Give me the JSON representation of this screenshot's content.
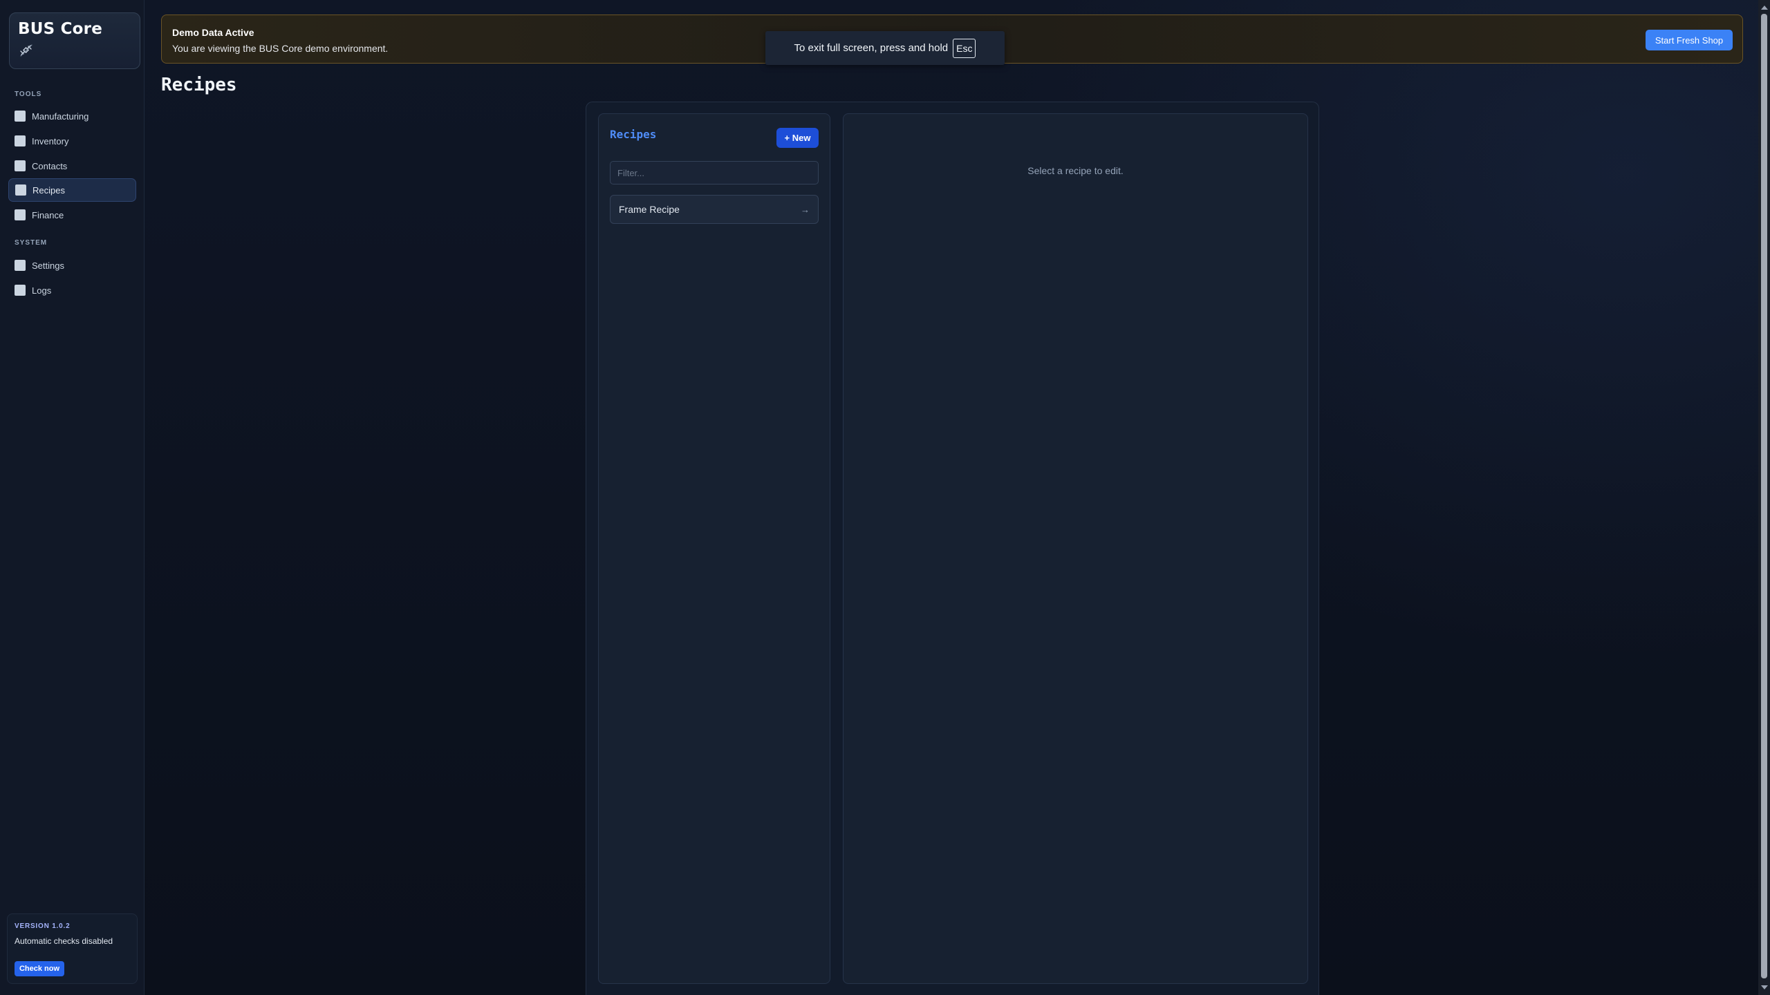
{
  "brand": {
    "title": "BUS Core",
    "icon": "satellite-icon"
  },
  "sidebar": {
    "sections": [
      {
        "label": "TOOLS",
        "items": [
          {
            "label": "Manufacturing",
            "active": false
          },
          {
            "label": "Inventory",
            "active": false
          },
          {
            "label": "Contacts",
            "active": false
          },
          {
            "label": "Recipes",
            "active": true
          },
          {
            "label": "Finance",
            "active": false
          }
        ]
      },
      {
        "label": "SYSTEM",
        "items": [
          {
            "label": "Settings",
            "active": false
          },
          {
            "label": "Logs",
            "active": false
          }
        ]
      }
    ],
    "version": {
      "label": "VERSION 1.0.2",
      "status": "Automatic checks disabled",
      "check_button": "Check now"
    }
  },
  "banner": {
    "title": "Demo Data Active",
    "text": "You are viewing the BUS Core demo environment.",
    "button": "Start Fresh Shop"
  },
  "fullscreen_toast": {
    "text": "To exit full screen, press and hold",
    "key": "Esc"
  },
  "page": {
    "title": "Recipes"
  },
  "recipes_panel": {
    "title": "Recipes",
    "new_button": "+ New",
    "filter_placeholder": "Filter...",
    "items": [
      {
        "name": "Frame Recipe",
        "arrow": "→"
      }
    ]
  },
  "detail_panel": {
    "empty_text": "Select a recipe to edit."
  },
  "colors": {
    "accent": "#3b82f6",
    "accent_dark": "#1d4ed8",
    "banner_border": "#6b5426",
    "background": "#0c1220"
  }
}
